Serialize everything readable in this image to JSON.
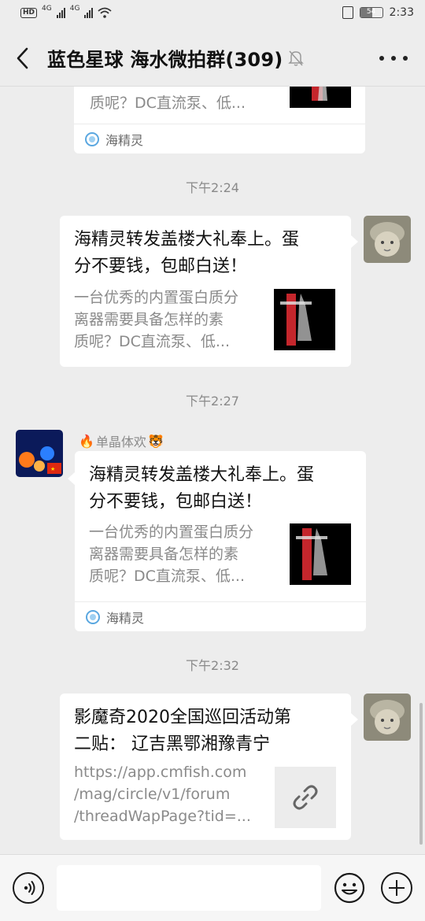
{
  "status_bar": {
    "hd": "HD",
    "net1": "4G",
    "net2": "4G",
    "battery_level": "54",
    "time": "2:33"
  },
  "header": {
    "title": "蓝色星球 海水微拍群(309)"
  },
  "messages": [
    {
      "partial": true,
      "desc_last_line": "质呢？DC直流泵、低...",
      "source": "海精灵"
    },
    {
      "timestamp": "下午2:24",
      "title": "海精灵转发盖楼大礼奉上。蛋分不要钱，包邮白送！",
      "title_line1": "海精灵转发盖楼大礼奉上。蛋",
      "title_line2": "分不要钱，包邮白送！",
      "desc_line1": "一台优秀的内置蛋白质分",
      "desc_line2": "离器需要具备怎样的素",
      "desc_line3": "质呢？DC直流泵、低..."
    },
    {
      "timestamp": "下午2:27",
      "sender": "单晶体欢",
      "title_line1": "海精灵转发盖楼大礼奉上。蛋",
      "title_line2": "分不要钱，包邮白送！",
      "desc_line1": "一台优秀的内置蛋白质分",
      "desc_line2": "离器需要具备怎样的素",
      "desc_line3": "质呢？DC直流泵、低...",
      "source": "海精灵"
    },
    {
      "timestamp": "下午2:32",
      "title_line1": "影魔奇2020全国巡回活动第",
      "title_line2": "二贴： 辽吉黑鄂湘豫青宁",
      "desc_line1": "https://app.cmfish.com",
      "desc_line2": "/mag/circle/v1/forum",
      "desc_line3": "/threadWapPage?tid=..."
    }
  ],
  "input_bar": {
    "placeholder": ""
  },
  "colors": {
    "background": "#ededed",
    "bubble": "#ffffff",
    "muted_text": "#8a8a8a"
  }
}
